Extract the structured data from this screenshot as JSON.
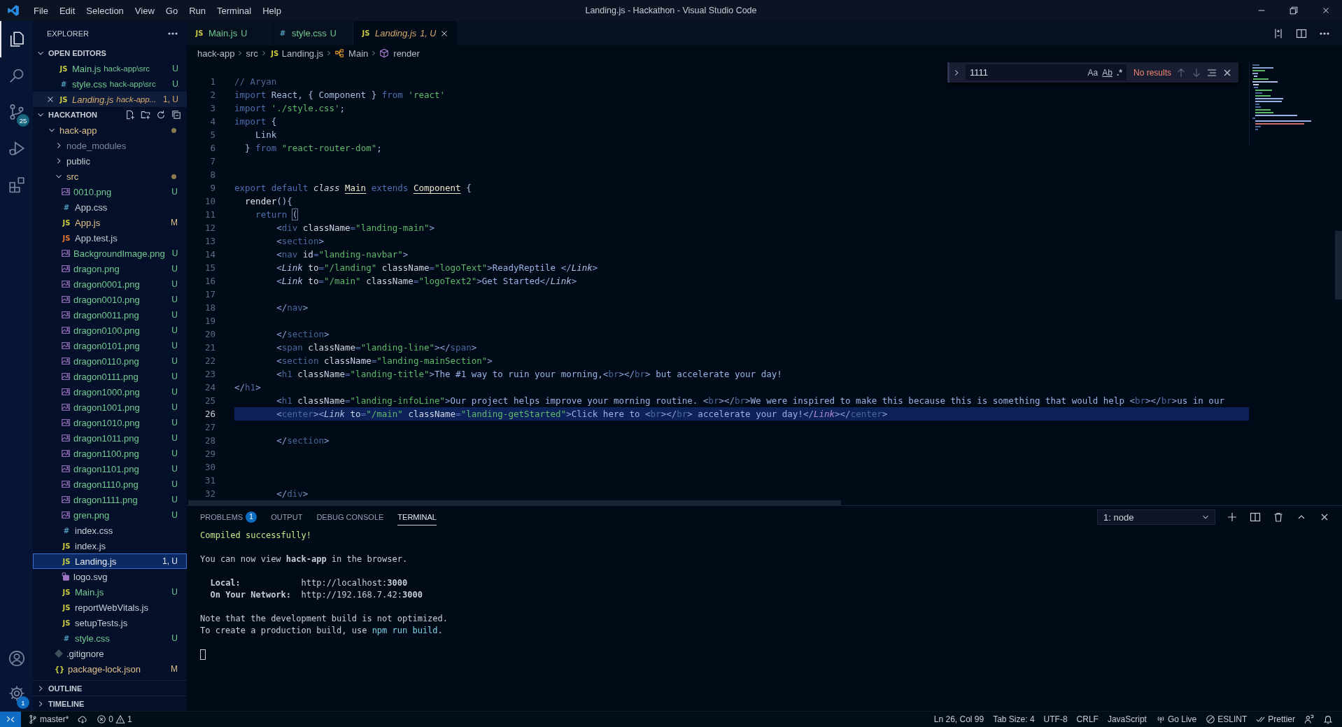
{
  "window": {
    "title": "Landing.js - Hackathon - Visual Studio Code"
  },
  "menu": [
    "File",
    "Edit",
    "Selection",
    "View",
    "Go",
    "Run",
    "Terminal",
    "Help"
  ],
  "activity_bar": {
    "top": [
      {
        "selected": true
      },
      {
        "selected": false
      },
      {
        "selected": false,
        "badge": "25"
      },
      {
        "selected": false
      },
      {
        "selected": false
      }
    ],
    "bottom": [
      {
        "selected": false
      },
      {
        "selected": false,
        "badge": "1"
      }
    ]
  },
  "explorer": {
    "title": "EXPLORER",
    "open_editors": {
      "title": "OPEN EDITORS",
      "expanded": true,
      "items": [
        {
          "glyph": "JS",
          "kind": "js",
          "name": "Main.js",
          "path": "hack-app\\src",
          "status": "U",
          "color": "#73c991",
          "preview": false,
          "active": false
        },
        {
          "glyph": "#",
          "kind": "css",
          "name": "style.css",
          "path": "hack-app\\src",
          "status": "U",
          "color": "#73c991",
          "preview": false,
          "active": false
        },
        {
          "glyph": "JS",
          "kind": "js",
          "name": "Landing.js",
          "path": "hack-app...",
          "status": "1, U",
          "color": "#d6a86c",
          "preview": true,
          "active": true
        }
      ]
    },
    "workspace": {
      "title": "HACKATHON",
      "expanded": true,
      "tree": [
        {
          "name": "hack-app",
          "kind": "folder",
          "expanded": true,
          "modified": true,
          "color": "#e2c08d",
          "selected": false,
          "children": [
            {
              "name": "node_modules",
              "kind": "folder",
              "expanded": false,
              "modified": false,
              "color": "#7f8796",
              "selected": false
            },
            {
              "name": "public",
              "kind": "folder",
              "expanded": false,
              "modified": false,
              "color": "#c8ccd4",
              "selected": false
            },
            {
              "name": "src",
              "kind": "folder",
              "expanded": true,
              "modified": true,
              "color": "#e2c08d",
              "selected": false,
              "children": [
                {
                  "name": "0010.png",
                  "kind": "image",
                  "status": "U",
                  "color": "#73c991",
                  "selected": false
                },
                {
                  "name": "App.css",
                  "kind": "css",
                  "glyph": "#",
                  "color": "#c8ccd4",
                  "selected": false
                },
                {
                  "name": "App.js",
                  "kind": "js",
                  "glyph": "JS",
                  "status": "M",
                  "color": "#e2c08d",
                  "selected": false
                },
                {
                  "name": "App.test.js",
                  "kind": "test",
                  "glyph": "JS",
                  "color": "#c8ccd4",
                  "selected": false
                },
                {
                  "name": "BackgroundImage.png",
                  "kind": "image",
                  "status": "U",
                  "color": "#73c991",
                  "selected": false
                },
                {
                  "name": "dragon.png",
                  "kind": "image",
                  "status": "U",
                  "color": "#73c991",
                  "selected": false
                },
                {
                  "name": "dragon0001.png",
                  "kind": "image",
                  "status": "U",
                  "color": "#73c991",
                  "selected": false
                },
                {
                  "name": "dragon0010.png",
                  "kind": "image",
                  "status": "U",
                  "color": "#73c991",
                  "selected": false
                },
                {
                  "name": "dragon0011.png",
                  "kind": "image",
                  "status": "U",
                  "color": "#73c991",
                  "selected": false
                },
                {
                  "name": "dragon0100.png",
                  "kind": "image",
                  "status": "U",
                  "color": "#73c991",
                  "selected": false
                },
                {
                  "name": "dragon0101.png",
                  "kind": "image",
                  "status": "U",
                  "color": "#73c991",
                  "selected": false
                },
                {
                  "name": "dragon0110.png",
                  "kind": "image",
                  "status": "U",
                  "color": "#73c991",
                  "selected": false
                },
                {
                  "name": "dragon0111.png",
                  "kind": "image",
                  "status": "U",
                  "color": "#73c991",
                  "selected": false
                },
                {
                  "name": "dragon1000.png",
                  "kind": "image",
                  "status": "U",
                  "color": "#73c991",
                  "selected": false
                },
                {
                  "name": "dragon1001.png",
                  "kind": "image",
                  "status": "U",
                  "color": "#73c991",
                  "selected": false
                },
                {
                  "name": "dragon1010.png",
                  "kind": "image",
                  "status": "U",
                  "color": "#73c991",
                  "selected": false
                },
                {
                  "name": "dragon1011.png",
                  "kind": "image",
                  "status": "U",
                  "color": "#73c991",
                  "selected": false
                },
                {
                  "name": "dragon1100.png",
                  "kind": "image",
                  "status": "U",
                  "color": "#73c991",
                  "selected": false
                },
                {
                  "name": "dragon1101.png",
                  "kind": "image",
                  "status": "U",
                  "color": "#73c991",
                  "selected": false
                },
                {
                  "name": "dragon1110.png",
                  "kind": "image",
                  "status": "U",
                  "color": "#73c991",
                  "selected": false
                },
                {
                  "name": "dragon1111.png",
                  "kind": "image",
                  "status": "U",
                  "color": "#73c991",
                  "selected": false
                },
                {
                  "name": "gren.png",
                  "kind": "image",
                  "status": "U",
                  "color": "#73c991",
                  "selected": false
                },
                {
                  "name": "index.css",
                  "kind": "css",
                  "glyph": "#",
                  "color": "#c8ccd4",
                  "selected": false
                },
                {
                  "name": "index.js",
                  "kind": "js",
                  "glyph": "JS",
                  "color": "#c8ccd4",
                  "selected": false
                },
                {
                  "name": "Landing.js",
                  "kind": "js",
                  "glyph": "JS",
                  "status": "1, U",
                  "color": "#e8ecf4",
                  "selected": true
                },
                {
                  "name": "logo.svg",
                  "kind": "svg",
                  "color": "#c8ccd4",
                  "selected": false
                },
                {
                  "name": "Main.js",
                  "kind": "js",
                  "glyph": "JS",
                  "status": "U",
                  "color": "#73c991",
                  "selected": false
                },
                {
                  "name": "reportWebVitals.js",
                  "kind": "js",
                  "glyph": "JS",
                  "color": "#c8ccd4",
                  "selected": false
                },
                {
                  "name": "setupTests.js",
                  "kind": "js",
                  "glyph": "JS",
                  "color": "#c8ccd4",
                  "selected": false
                },
                {
                  "name": "style.css",
                  "kind": "css",
                  "glyph": "#",
                  "status": "U",
                  "color": "#73c991",
                  "selected": false
                }
              ]
            },
            {
              "name": ".gitignore",
              "kind": "git",
              "color": "#c8ccd4",
              "selected": false
            },
            {
              "name": "package-lock.json",
              "kind": "json",
              "glyph": "{}",
              "status": "M",
              "color": "#e2c08d",
              "selected": false
            }
          ]
        }
      ]
    },
    "sections": [
      {
        "title": "OUTLINE",
        "expanded": false
      },
      {
        "title": "TIMELINE",
        "expanded": false
      }
    ]
  },
  "tabs": [
    {
      "glyph": "JS",
      "kind": "js",
      "name": "Main.js",
      "status": "U",
      "color": "#73c991",
      "selected": false,
      "preview": false
    },
    {
      "glyph": "#",
      "kind": "css",
      "name": "style.css",
      "status": "U",
      "color": "#73c991",
      "selected": false,
      "preview": false
    },
    {
      "glyph": "JS",
      "kind": "js",
      "name": "Landing.js",
      "status": "1, U",
      "color": "#d6a86c",
      "selected": true,
      "preview": true
    }
  ],
  "breadcrumbs": [
    {
      "kind": "folder",
      "text": "hack-app"
    },
    {
      "kind": "folder",
      "text": "src"
    },
    {
      "kind": "file",
      "glyph": "JS",
      "text": "Landing.js"
    },
    {
      "kind": "class",
      "text": "Main"
    },
    {
      "kind": "method",
      "text": "render"
    }
  ],
  "find": {
    "replace_expanded": false,
    "query": "1111",
    "options": [
      {
        "label": "Aa",
        "selected": false
      },
      {
        "label": "Ab",
        "selected": false
      },
      {
        "label": ".*",
        "selected": false
      }
    ],
    "message": "No results"
  },
  "editor": {
    "lines": [
      {
        "n": "1",
        "current": false,
        "tokens": [
          {
            "kind": "comment",
            "text": "// Aryan"
          }
        ]
      },
      {
        "n": "2",
        "current": false,
        "tokens": [
          {
            "kind": "kw",
            "text": "import"
          },
          {
            "kind": "id",
            "text": " React, { Component } "
          },
          {
            "kind": "kw",
            "text": "from"
          },
          {
            "kind": "str",
            "text": " 'react'"
          }
        ]
      },
      {
        "n": "3",
        "current": false,
        "tokens": [
          {
            "kind": "kw",
            "text": "import"
          },
          {
            "kind": "str",
            "text": " './style.css'"
          },
          {
            "kind": "id",
            "text": ";"
          }
        ]
      },
      {
        "n": "4",
        "current": false,
        "tokens": [
          {
            "kind": "kw",
            "text": "import"
          },
          {
            "kind": "id",
            "text": " {"
          }
        ]
      },
      {
        "n": "5",
        "current": false,
        "tokens": [
          {
            "kind": "id",
            "text": "    Link"
          }
        ]
      },
      {
        "n": "6",
        "current": false,
        "tokens": [
          {
            "kind": "id",
            "text": "  } "
          },
          {
            "kind": "kw",
            "text": "from"
          },
          {
            "kind": "str",
            "text": " \"react-router-dom\""
          },
          {
            "kind": "id",
            "text": ";"
          }
        ]
      },
      {
        "n": "7",
        "current": false
      },
      {
        "n": "8",
        "current": false
      },
      {
        "n": "9",
        "current": false,
        "tokens": [
          {
            "kind": "kw",
            "text": "export default "
          },
          {
            "kind": "ital",
            "text": "class "
          },
          {
            "kind": "cls",
            "text": "Main"
          },
          {
            "kind": "kw",
            "text": " extends "
          },
          {
            "kind": "cls",
            "text": "Component"
          },
          {
            "kind": "id",
            "text": " {"
          }
        ]
      },
      {
        "n": "10",
        "current": false,
        "tokens": [
          {
            "kind": "fn",
            "text": "  render"
          },
          {
            "kind": "id",
            "text": "(){"
          }
        ]
      },
      {
        "n": "11",
        "current": false,
        "tokens": [
          {
            "kind": "kw",
            "text": "    return "
          },
          {
            "kind": "brk",
            "text": "("
          }
        ]
      },
      {
        "n": "12",
        "current": false,
        "tokens": [
          {
            "kind": "punct",
            "text": "        <"
          },
          {
            "kind": "tag",
            "text": "div"
          },
          {
            "kind": "attr",
            "text": " className"
          },
          {
            "kind": "eq",
            "text": "="
          },
          {
            "kind": "str",
            "text": "\"landing-main\""
          },
          {
            "kind": "punct",
            "text": ">"
          }
        ]
      },
      {
        "n": "13",
        "current": false,
        "tokens": [
          {
            "kind": "punct",
            "text": "        <"
          },
          {
            "kind": "tag",
            "text": "section"
          },
          {
            "kind": "punct",
            "text": ">"
          }
        ]
      },
      {
        "n": "14",
        "current": false,
        "tokens": [
          {
            "kind": "punct",
            "text": "        <"
          },
          {
            "kind": "tag",
            "text": "nav"
          },
          {
            "kind": "attr",
            "text": " id"
          },
          {
            "kind": "eq",
            "text": "="
          },
          {
            "kind": "str",
            "text": "\"landing-navbar\""
          },
          {
            "kind": "punct",
            "text": ">"
          }
        ]
      },
      {
        "n": "15",
        "current": false,
        "tokens": [
          {
            "kind": "punct",
            "text": "        <"
          },
          {
            "kind": "comp",
            "text": "Link"
          },
          {
            "kind": "attr",
            "text": " to"
          },
          {
            "kind": "eq",
            "text": "="
          },
          {
            "kind": "str",
            "text": "\"/landing\""
          },
          {
            "kind": "attr",
            "text": " className"
          },
          {
            "kind": "eq",
            "text": "="
          },
          {
            "kind": "str",
            "text": "\"logoText\""
          },
          {
            "kind": "punct",
            "text": ">"
          },
          {
            "kind": "text",
            "text": "ReadyReptile "
          },
          {
            "kind": "punct",
            "text": "</"
          },
          {
            "kind": "comp",
            "text": "Link"
          },
          {
            "kind": "punct",
            "text": ">"
          }
        ]
      },
      {
        "n": "16",
        "current": false,
        "tokens": [
          {
            "kind": "punct",
            "text": "        <"
          },
          {
            "kind": "comp",
            "text": "Link"
          },
          {
            "kind": "attr",
            "text": " to"
          },
          {
            "kind": "eq",
            "text": "="
          },
          {
            "kind": "str",
            "text": "\"/main\""
          },
          {
            "kind": "attr",
            "text": " className"
          },
          {
            "kind": "eq",
            "text": "="
          },
          {
            "kind": "str",
            "text": "\"logoText2\""
          },
          {
            "kind": "punct",
            "text": ">"
          },
          {
            "kind": "text",
            "text": "Get Started"
          },
          {
            "kind": "punct",
            "text": "</"
          },
          {
            "kind": "comp",
            "text": "Link"
          },
          {
            "kind": "punct",
            "text": ">"
          }
        ]
      },
      {
        "n": "17",
        "current": false
      },
      {
        "n": "18",
        "current": false,
        "tokens": [
          {
            "kind": "punct",
            "text": "        </"
          },
          {
            "kind": "tag",
            "text": "nav"
          },
          {
            "kind": "punct",
            "text": ">"
          }
        ]
      },
      {
        "n": "19",
        "current": false
      },
      {
        "n": "20",
        "current": false,
        "tokens": [
          {
            "kind": "punct",
            "text": "        </"
          },
          {
            "kind": "tag",
            "text": "section"
          },
          {
            "kind": "punct",
            "text": ">"
          }
        ]
      },
      {
        "n": "21",
        "current": false,
        "tokens": [
          {
            "kind": "punct",
            "text": "        <"
          },
          {
            "kind": "tag",
            "text": "span"
          },
          {
            "kind": "attr",
            "text": " className"
          },
          {
            "kind": "eq",
            "text": "="
          },
          {
            "kind": "str",
            "text": "\"landing-line\""
          },
          {
            "kind": "punct",
            "text": "></"
          },
          {
            "kind": "tag",
            "text": "span"
          },
          {
            "kind": "punct",
            "text": ">"
          }
        ]
      },
      {
        "n": "22",
        "current": false,
        "tokens": [
          {
            "kind": "punct",
            "text": "        <"
          },
          {
            "kind": "tag",
            "text": "section"
          },
          {
            "kind": "attr",
            "text": " className"
          },
          {
            "kind": "eq",
            "text": "="
          },
          {
            "kind": "str",
            "text": "\"landing-mainSection\""
          },
          {
            "kind": "punct",
            "text": ">"
          }
        ]
      },
      {
        "n": "23",
        "current": false,
        "tokens": [
          {
            "kind": "punct",
            "text": "        <"
          },
          {
            "kind": "tag",
            "text": "h1"
          },
          {
            "kind": "attr",
            "text": " className"
          },
          {
            "kind": "eq",
            "text": "="
          },
          {
            "kind": "str",
            "text": "\"landing-title\""
          },
          {
            "kind": "punct",
            "text": ">"
          },
          {
            "kind": "text",
            "text": "The #1 way to ruin your morning,"
          },
          {
            "kind": "punct",
            "text": "<"
          },
          {
            "kind": "tag",
            "text": "br"
          },
          {
            "kind": "punct",
            "text": "></"
          },
          {
            "kind": "tag",
            "text": "br"
          },
          {
            "kind": "punct",
            "text": ">"
          },
          {
            "kind": "text",
            "text": " but accelerate your day!"
          }
        ]
      },
      {
        "n": "24",
        "current": false,
        "tokens": [
          {
            "kind": "punct",
            "text": "</"
          },
          {
            "kind": "tag",
            "text": "h1"
          },
          {
            "kind": "punct",
            "text": ">"
          }
        ]
      },
      {
        "n": "25",
        "current": false,
        "tokens": [
          {
            "kind": "punct",
            "text": "        <"
          },
          {
            "kind": "tag",
            "text": "h1"
          },
          {
            "kind": "attr",
            "text": " className"
          },
          {
            "kind": "eq",
            "text": "="
          },
          {
            "kind": "str",
            "text": "\"landing-infoLine\""
          },
          {
            "kind": "punct",
            "text": ">"
          },
          {
            "kind": "text",
            "text": "Our project helps improve your morning routine. "
          },
          {
            "kind": "punct",
            "text": "<"
          },
          {
            "kind": "tag",
            "text": "br"
          },
          {
            "kind": "punct",
            "text": "></"
          },
          {
            "kind": "tag",
            "text": "br"
          },
          {
            "kind": "punct",
            "text": ">"
          },
          {
            "kind": "text",
            "text": "We were inspired to make this because this is something that would help "
          },
          {
            "kind": "punct",
            "text": "<"
          },
          {
            "kind": "tag",
            "text": "br"
          },
          {
            "kind": "punct",
            "text": "></"
          },
          {
            "kind": "tag",
            "text": "br"
          },
          {
            "kind": "punct",
            "text": ">"
          },
          {
            "kind": "text",
            "text": "us in our"
          }
        ]
      },
      {
        "n": "26",
        "current": true,
        "tokens": [
          {
            "kind": "punct",
            "text": "        <"
          },
          {
            "kind": "tag",
            "text": "center"
          },
          {
            "kind": "punct",
            "text": "><"
          },
          {
            "kind": "comp",
            "text": "Link"
          },
          {
            "kind": "attr",
            "text": " to"
          },
          {
            "kind": "eq",
            "text": "="
          },
          {
            "kind": "str",
            "text": "\"/main\""
          },
          {
            "kind": "attr",
            "text": " className"
          },
          {
            "kind": "eq",
            "text": "="
          },
          {
            "kind": "str",
            "text": "\"landing-getStarted\""
          },
          {
            "kind": "punct",
            "text": ">"
          },
          {
            "kind": "text",
            "text": "Click here to "
          },
          {
            "kind": "punct",
            "text": "<"
          },
          {
            "kind": "tag",
            "text": "br"
          },
          {
            "kind": "punct",
            "text": "></"
          },
          {
            "kind": "tag",
            "text": "br"
          },
          {
            "kind": "punct",
            "text": ">"
          },
          {
            "kind": "text",
            "text": " accelerate your day!"
          },
          {
            "kind": "punct",
            "text": "</"
          },
          {
            "kind": "comp2",
            "text": "Link"
          },
          {
            "kind": "punct",
            "text": "></"
          },
          {
            "kind": "tag",
            "text": "center"
          },
          {
            "kind": "punct",
            "text": ">"
          }
        ]
      },
      {
        "n": "27",
        "current": false
      },
      {
        "n": "28",
        "current": false,
        "tokens": [
          {
            "kind": "punct",
            "text": "        </"
          },
          {
            "kind": "tag",
            "text": "section"
          },
          {
            "kind": "punct",
            "text": ">"
          }
        ]
      },
      {
        "n": "29",
        "current": false
      },
      {
        "n": "30",
        "current": false
      },
      {
        "n": "31",
        "current": false
      },
      {
        "n": "32",
        "current": false,
        "tokens": [
          {
            "kind": "punct",
            "text": "        </"
          },
          {
            "kind": "tag",
            "text": "div"
          },
          {
            "kind": "punct",
            "text": ">"
          }
        ]
      }
    ]
  },
  "panel": {
    "tabs": [
      {
        "label": "PROBLEMS",
        "badge": "1",
        "selected": false
      },
      {
        "label": "OUTPUT",
        "selected": false
      },
      {
        "label": "DEBUG CONSOLE",
        "selected": false
      },
      {
        "label": "TERMINAL",
        "selected": true
      }
    ],
    "terminal_select": "1: node",
    "terminal_lines": [
      {
        "kind": "success",
        "text": "Compiled successfully!"
      },
      {
        "kind": "blank"
      },
      {
        "kind": "text",
        "text": "You can now view **hack-app** in the browser."
      },
      {
        "kind": "blank"
      },
      {
        "kind": "text",
        "text": "  **Local:**            http://localhost:**3000**"
      },
      {
        "kind": "text",
        "text": "  **On Your Network:**  http://192.168.7.42:**3000**"
      },
      {
        "kind": "blank"
      },
      {
        "kind": "text",
        "text": "Note that the development build is not optimized."
      },
      {
        "kind": "command",
        "text": "To create a production build, use ",
        "command": "npm run build",
        "after": "."
      },
      {
        "kind": "blank"
      },
      {
        "kind": "cursor"
      }
    ]
  },
  "status_bar": {
    "branch": "master*",
    "errors": "0",
    "warnings": "1",
    "right": [
      "Ln 26, Col 99",
      "Tab Size: 4",
      "UTF-8",
      "CRLF",
      "JavaScript",
      "Go Live",
      "ESLINT",
      "Prettier"
    ]
  }
}
